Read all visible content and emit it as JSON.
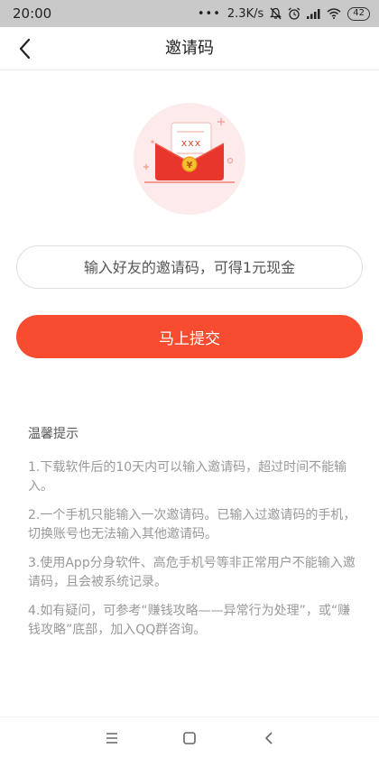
{
  "status_bar": {
    "time": "20:00",
    "dots": "•••",
    "speed": "2.3K/s",
    "battery": "42",
    "icons": [
      "mute-icon",
      "alarm-icon",
      "signal-icon",
      "wifi-icon",
      "battery-icon"
    ]
  },
  "nav": {
    "title": "邀请码",
    "back_icon": "chevron-left-icon"
  },
  "hero": {
    "card_text": "xxx",
    "coin_symbol": "¥"
  },
  "invite": {
    "placeholder": "输入好友的邀请码，可得1元现金",
    "value": ""
  },
  "submit": {
    "label": "马上提交",
    "color": "#f74c30"
  },
  "tips": {
    "title": "温馨提示",
    "items": [
      "1.下载软件后的10天内可以输入邀请码，超过时间不能输入。",
      "2.一个手机只能输入一次邀请码。已输入过邀请码的手机，切换账号也无法输入其他邀请码。",
      "3.使用App分身软件、高危手机号等非正常用户不能输入邀请码，且会被系统记录。",
      "4.如有疑问，可参考“赚钱攻略——异常行为处理”，或“赚钱攻略”底部，加入QQ群咨询。"
    ]
  },
  "system_nav": {
    "icons": [
      "menu-icon",
      "home-icon",
      "back-icon"
    ]
  }
}
